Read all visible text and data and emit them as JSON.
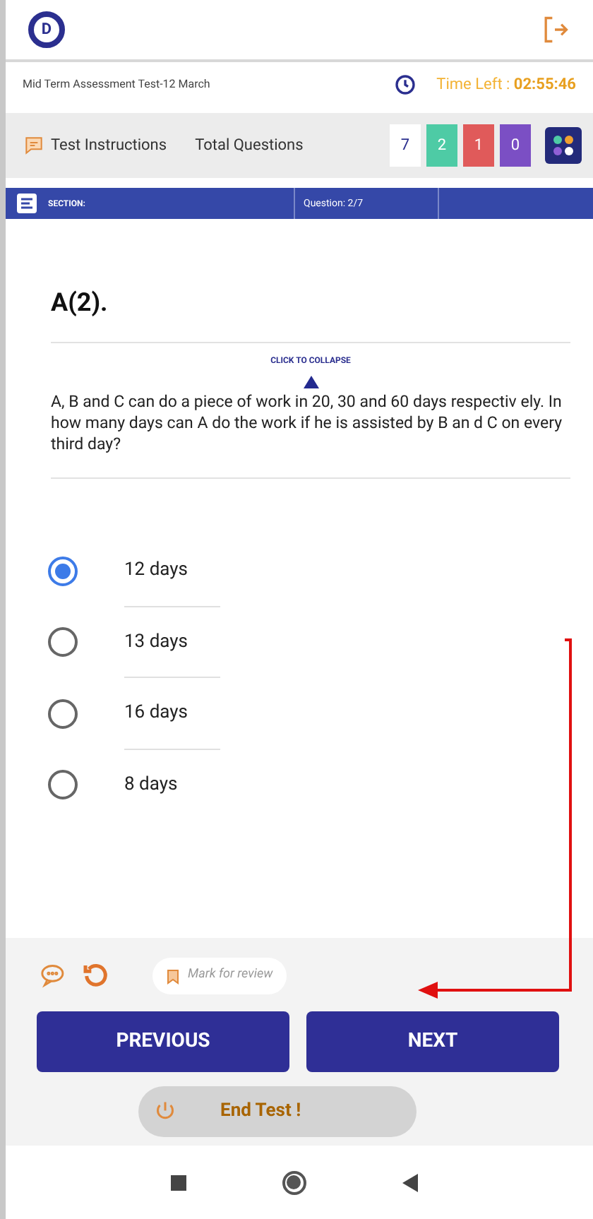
{
  "logo": {
    "letter": "D"
  },
  "test_title": "Mid Term Assessment Test-12 March",
  "timer": {
    "label": "Time Left : ",
    "value": "02:55:46"
  },
  "toolbar": {
    "instructions": "Test Instructions",
    "total_questions": "Total Questions",
    "counts": [
      {
        "value": "7",
        "color": "#ffffff"
      },
      {
        "value": "2",
        "color": "#4ecba5"
      },
      {
        "value": "1",
        "color": "#e05a5a"
      },
      {
        "value": "0",
        "color": "#7b4fc4"
      }
    ]
  },
  "section_bar": {
    "section": "SECTION:",
    "question": "Question: 2/7"
  },
  "question": {
    "number": "A(2).",
    "collapse": "CLICK TO COLLAPSE",
    "text": "A, B and C can do a piece of work in 20, 30 and 60 days respectiv ely. In how many days can A do the work if he is assisted by B an d C on every third day?"
  },
  "options": [
    {
      "label": "12 days",
      "selected": true
    },
    {
      "label": "13 days",
      "selected": false
    },
    {
      "label": "16 days",
      "selected": false
    },
    {
      "label": "8 days",
      "selected": false
    }
  ],
  "mark_for_review": "Mark for review",
  "buttons": {
    "previous": "PREVIOUS",
    "next": "NEXT",
    "end_test": "End Test !"
  }
}
